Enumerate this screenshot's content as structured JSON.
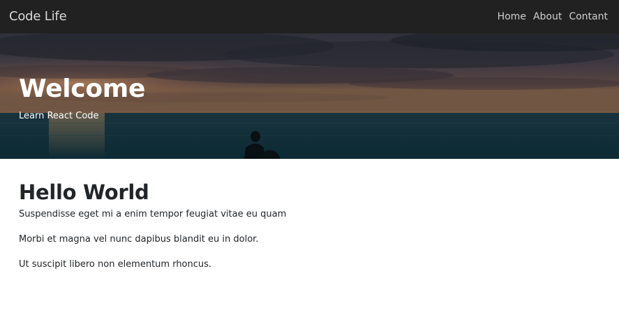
{
  "navbar": {
    "brand": "Code Life",
    "links": [
      "Home",
      "About",
      "Contant"
    ]
  },
  "hero": {
    "title": "Welcome",
    "subtitle": "Learn React Code"
  },
  "main": {
    "heading": "Hello World",
    "paragraphs": [
      "Suspendisse eget mi a enim tempor feugiat vitae eu quam",
      "Morbi et magna vel nunc dapibus blandit eu in dolor.",
      "Ut suscipit libero non elementum rhoncus."
    ]
  },
  "colors": {
    "navbar_bg": "#212121",
    "text": "#212529",
    "hero_text": "#ffffff"
  }
}
